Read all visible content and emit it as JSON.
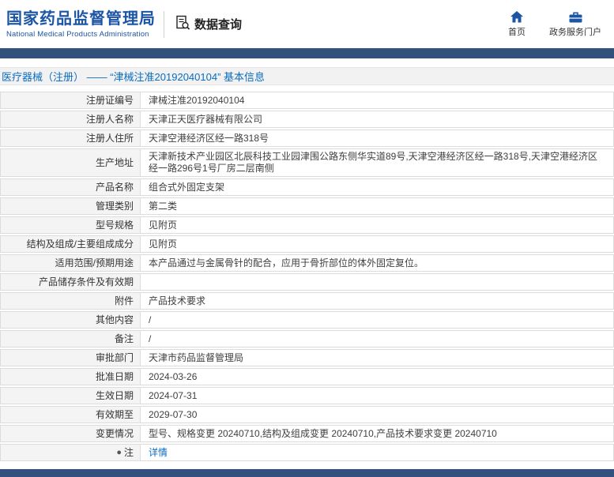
{
  "colors": {
    "brand_blue": "#1b55a4",
    "navy_bar": "#33517d",
    "link_blue": "#0a6cc0",
    "label_cell_bg": "#f4f4f4"
  },
  "header": {
    "logo_title": "国家药品监督管理局",
    "logo_subtitle": "National Medical Products Administration",
    "section_label": "数据查询",
    "nav": [
      {
        "label": "首页"
      },
      {
        "label": "政务服务门户"
      }
    ]
  },
  "page": {
    "title": "医疗器械（注册） —— “津械注准20192040104” 基本信息"
  },
  "table": {
    "note_icon": "●",
    "rows": [
      {
        "label": "注册证编号",
        "value": "津械注准20192040104"
      },
      {
        "label": "注册人名称",
        "value": "天津正天医疗器械有限公司"
      },
      {
        "label": "注册人住所",
        "value": "天津空港经济区经一路318号"
      },
      {
        "label": "生产地址",
        "value": "天津新技术产业园区北辰科技工业园津围公路东侧华实道89号,天津空港经济区经一路318号,天津空港经济区经一路296号1号厂房二层南侧"
      },
      {
        "label": "产品名称",
        "value": "组合式外固定支架"
      },
      {
        "label": "管理类别",
        "value": "第二类"
      },
      {
        "label": "型号规格",
        "value": "见附页"
      },
      {
        "label": "结构及组成/主要组成成分",
        "value": "见附页"
      },
      {
        "label": "适用范围/预期用途",
        "value": "本产品通过与金属骨针的配合，应用于骨折部位的体外固定复位。"
      },
      {
        "label": "产品储存条件及有效期",
        "value": ""
      },
      {
        "label": "附件",
        "value": "产品技术要求"
      },
      {
        "label": "其他内容",
        "value": "/"
      },
      {
        "label": "备注",
        "value": "/"
      },
      {
        "label": "审批部门",
        "value": "天津市药品监督管理局"
      },
      {
        "label": "批准日期",
        "value": "2024-03-26"
      },
      {
        "label": "生效日期",
        "value": "2024-07-31"
      },
      {
        "label": "有效期至",
        "value": "2029-07-30"
      },
      {
        "label": "变更情况",
        "value": "型号、规格变更 20240710,结构及组成变更 20240710,产品技术要求变更 20240710"
      },
      {
        "label": "注",
        "value": "详情"
      }
    ]
  }
}
